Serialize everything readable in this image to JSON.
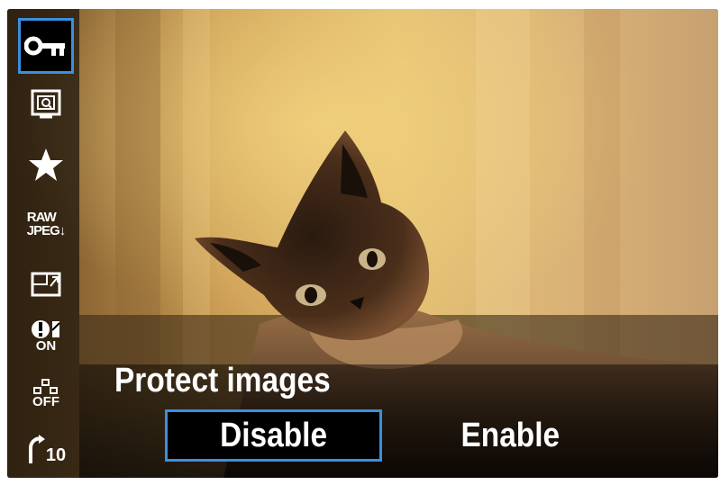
{
  "sidebar": {
    "items": [
      {
        "name": "protect",
        "icon": "key-icon",
        "selected": true
      },
      {
        "name": "rotate",
        "icon": "rotate-image-icon"
      },
      {
        "name": "rating",
        "icon": "star-icon"
      },
      {
        "name": "raw-processing",
        "icon": "raw-jpeg-icon",
        "label_top": "RAW",
        "label_bottom": "JPEG"
      },
      {
        "name": "resize",
        "icon": "resize-icon"
      },
      {
        "name": "highlight-alert",
        "icon": "highlight-alert-icon",
        "label": "ON"
      },
      {
        "name": "af-point-display",
        "icon": "af-point-icon",
        "label": "OFF"
      },
      {
        "name": "image-jump",
        "icon": "jump-icon",
        "label": "10"
      }
    ]
  },
  "menu": {
    "title": "Protect images",
    "options": [
      "Disable",
      "Enable"
    ],
    "selected_index": 0
  },
  "colors": {
    "selection_border": "#3a8fe0",
    "text": "#ffffff"
  }
}
